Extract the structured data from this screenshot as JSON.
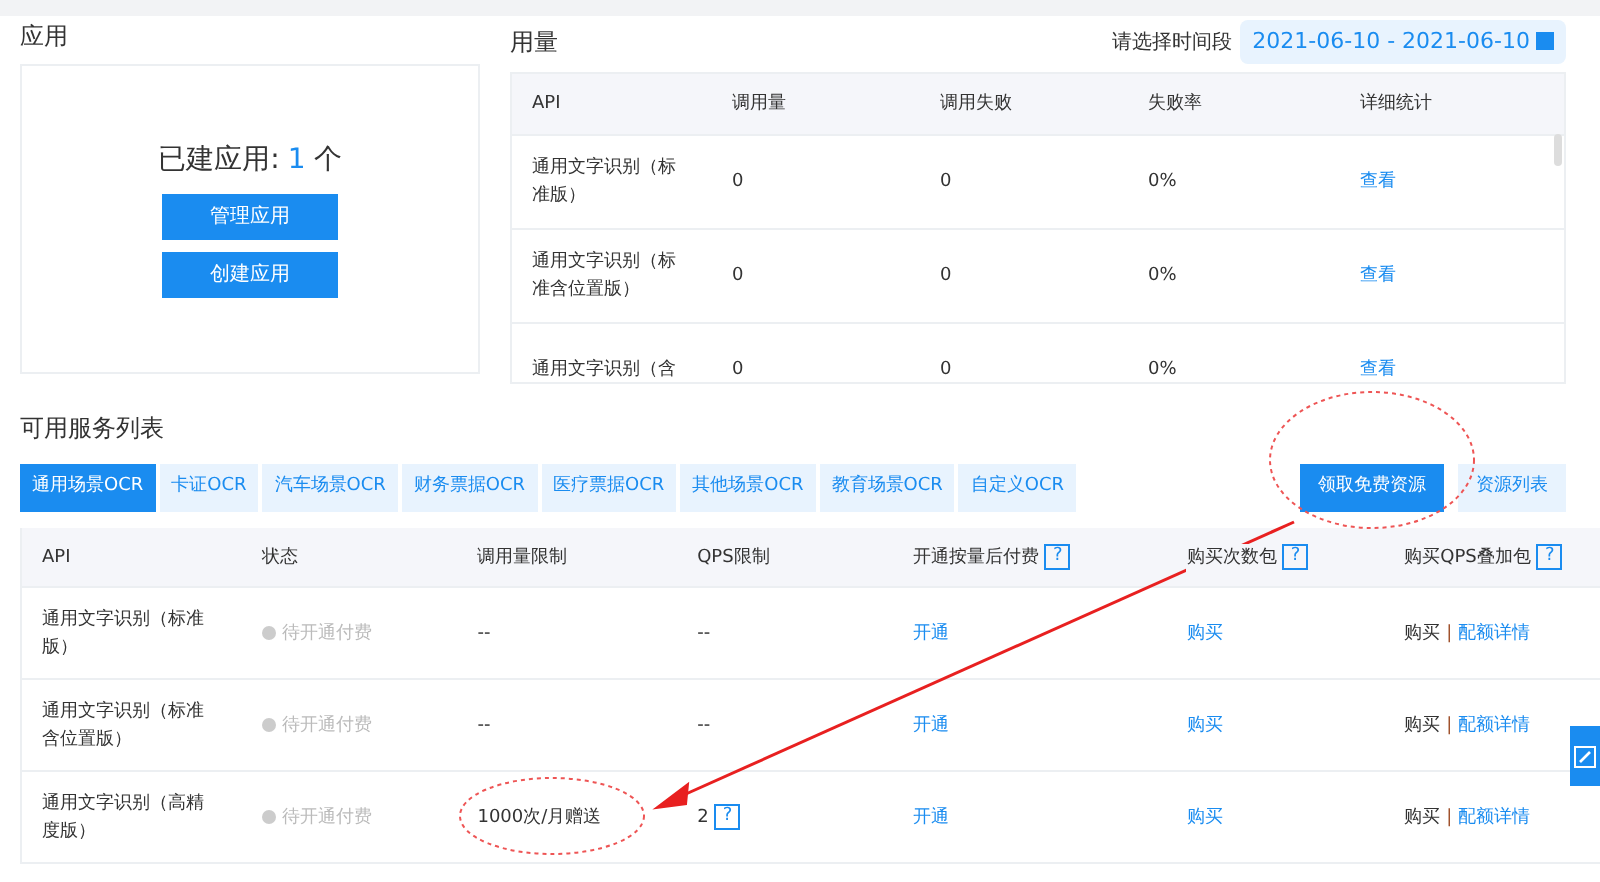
{
  "app_panel": {
    "title": "应用",
    "count_label": "已建应用:",
    "count": "1",
    "count_unit": "个",
    "buttons": [
      "管理应用",
      "创建应用"
    ]
  },
  "usage": {
    "title": "用量",
    "date_label": "请选择时间段",
    "date_range": "2021-06-10 - 2021-06-10",
    "columns": [
      "API",
      "调用量",
      "调用失败",
      "失败率",
      "详细统计"
    ],
    "rows": [
      {
        "api": "通用文字识别（标准版）",
        "calls": "0",
        "failures": "0",
        "rate": "0%",
        "detail": "查看"
      },
      {
        "api": "通用文字识别（标准含位置版）",
        "calls": "0",
        "failures": "0",
        "rate": "0%",
        "detail": "查看"
      },
      {
        "api": "通用文字识别（含",
        "calls": "0",
        "failures": "0",
        "rate": "0%",
        "detail": "查看"
      }
    ]
  },
  "services": {
    "title": "可用服务列表",
    "tabs": [
      {
        "label": "通用场景OCR",
        "selected": true
      },
      {
        "label": "卡证OCR",
        "selected": false
      },
      {
        "label": "汽车场景OCR",
        "selected": false
      },
      {
        "label": "财务票据OCR",
        "selected": false
      },
      {
        "label": "医疗票据OCR",
        "selected": false
      },
      {
        "label": "其他场景OCR",
        "selected": false
      },
      {
        "label": "教育场景OCR",
        "selected": false
      },
      {
        "label": "自定义OCR",
        "selected": false
      }
    ],
    "buttons": [
      {
        "label": "领取免费资源",
        "kind": "primary"
      },
      {
        "label": "资源列表",
        "kind": "light"
      }
    ],
    "columns": [
      {
        "label": "API"
      },
      {
        "label": "状态"
      },
      {
        "label": "调用量限制"
      },
      {
        "label": "QPS限制"
      },
      {
        "label": "开通按量后付费",
        "help": "?"
      },
      {
        "label": "购买次数包",
        "help": "?"
      },
      {
        "label": "购买QPS叠加包",
        "help": "?"
      }
    ],
    "rows": [
      {
        "api": "通用文字识别（标准版）",
        "status": "待开通付费",
        "call_limit": "--",
        "qps": "--",
        "postpaid": "开通",
        "pack": "购买",
        "qps_pack": "购买",
        "separator": "|",
        "quota": "配额详情"
      },
      {
        "api": "通用文字识别（标准含位置版）",
        "status": "待开通付费",
        "call_limit": "--",
        "qps": "--",
        "postpaid": "开通",
        "pack": "购买",
        "qps_pack": "购买",
        "separator": "|",
        "quota": "配额详情"
      },
      {
        "api": "通用文字识别（高精度版）",
        "status": "待开通付费",
        "call_limit": "1000次/月赠送",
        "qps": "2",
        "qps_help": "?",
        "postpaid": "开通",
        "pack": "购买",
        "qps_pack": "购买",
        "separator": "|",
        "quota": "配额详情"
      }
    ]
  }
}
